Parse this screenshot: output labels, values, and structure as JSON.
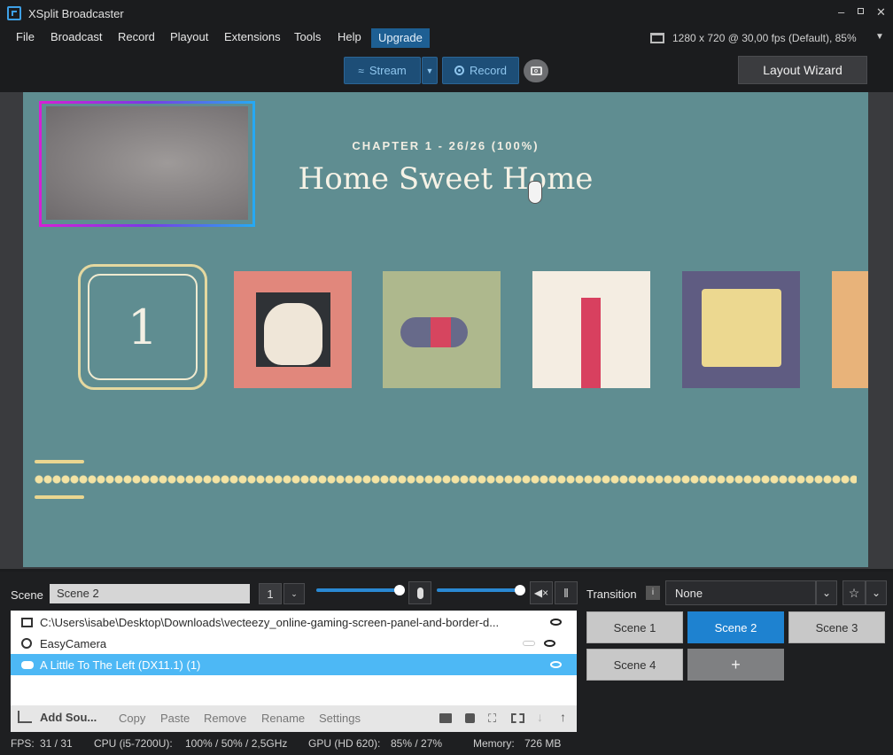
{
  "app": {
    "title": "XSplit Broadcaster"
  },
  "menu": {
    "items": [
      "File",
      "Broadcast",
      "Record",
      "Playout",
      "Extensions",
      "Tools",
      "Help"
    ],
    "upgrade": "Upgrade"
  },
  "resolution": "1280 x 720 @ 30,00 fps (Default), 85%",
  "toolbar": {
    "stream": "Stream",
    "record": "Record",
    "layout_wizard": "Layout Wizard"
  },
  "preview": {
    "chapter": "CHAPTER 1 - 26/26 (100%)",
    "title": "Home Sweet Home",
    "level_number": "1"
  },
  "scene": {
    "label": "Scene",
    "name": "Scene 2",
    "count": "1"
  },
  "sources": [
    {
      "label": "C:\\Users\\isabe\\Desktop\\Downloads\\vecteezy_online-gaming-screen-panel-and-border-d...",
      "icon": "image-icon",
      "selected": false
    },
    {
      "label": "EasyCamera",
      "icon": "webcam-icon",
      "selected": false
    },
    {
      "label": "A Little To The Left (DX11.1) (1)",
      "icon": "gamepad-icon",
      "selected": true
    }
  ],
  "source_actions": {
    "add": "Add Sou...",
    "copy": "Copy",
    "paste": "Paste",
    "remove": "Remove",
    "rename": "Rename",
    "settings": "Settings"
  },
  "transition": {
    "label": "Transition",
    "value": "None"
  },
  "scenes": [
    "Scene 1",
    "Scene 2",
    "Scene 3",
    "Scene 4"
  ],
  "scene_add": "+",
  "status": {
    "fps_label": "FPS:",
    "fps": "31 / 31",
    "cpu_label": "CPU (i5-7200U):",
    "cpu": "100% / 50% / 2,5GHz",
    "gpu_label": "GPU (HD 620):",
    "gpu": "85% / 27%",
    "mem_label": "Memory:",
    "mem": "726 MB"
  },
  "colors": {
    "accent": "#1e82d0",
    "preview_bg": "#5f8d91",
    "selected_row": "#4db8f5"
  }
}
